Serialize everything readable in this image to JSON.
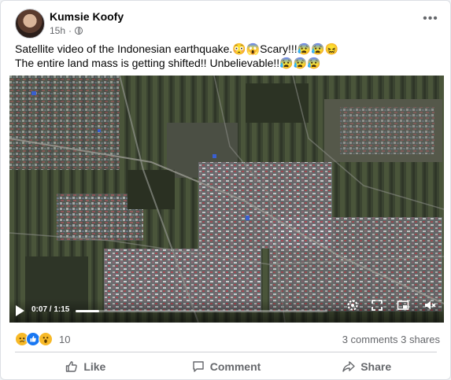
{
  "post": {
    "author": "Kumsie Koofy",
    "time": "15h",
    "dot": "·",
    "more": "•••",
    "text_line1": "Satellite video of the Indonesian earthquake.😳😱Scary!!!😰😰😖",
    "text_line2": "The entire land mass is getting shifted!! Unbelievable!!😰😰😰"
  },
  "video": {
    "current_time": "0:07",
    "duration": "1:15",
    "time_display": "0:07 / 1:15",
    "progress_fraction": 0.093
  },
  "reactions": {
    "count": "10",
    "comments": "3 comments",
    "shares": "3 shares",
    "icons": [
      "sad-icon",
      "like-icon",
      "wow-icon"
    ]
  },
  "actions": {
    "like": "Like",
    "comment": "Comment",
    "share": "Share"
  },
  "colors": {
    "like_blue": "#1877f2",
    "text_secondary": "#65676b",
    "reaction_yellow": "#f7b928"
  }
}
